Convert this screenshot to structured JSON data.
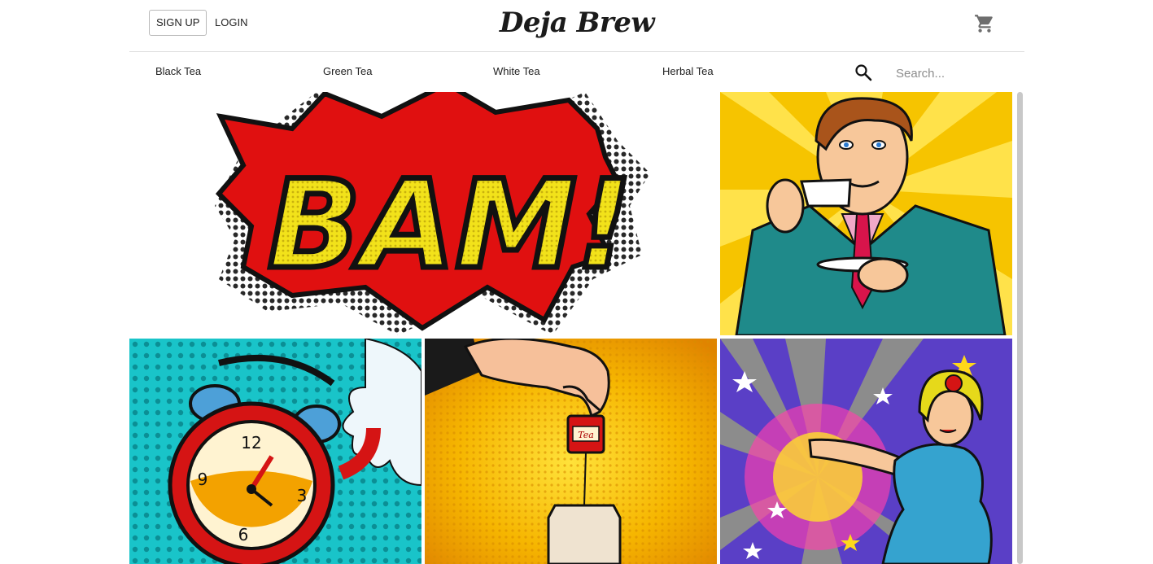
{
  "header": {
    "signup_label": "SIGN UP",
    "login_label": "LOGIN",
    "brand": "Deja Brew",
    "cart_icon": "shopping-cart-icon"
  },
  "nav": {
    "items": [
      {
        "label": "Black Tea"
      },
      {
        "label": "Green Tea"
      },
      {
        "label": "White Tea"
      },
      {
        "label": "Herbal Tea"
      }
    ],
    "search_icon": "search-icon",
    "search_placeholder": "Search..."
  },
  "gallery": {
    "tiles": [
      {
        "name": "bam-comic-tile",
        "caption": "BAM!"
      },
      {
        "name": "tea-gentleman-tile"
      },
      {
        "name": "teapot-clock-tile",
        "clock_numbers": [
          "12",
          "3",
          "6",
          "9"
        ]
      },
      {
        "name": "teabag-hand-tile",
        "tag_text": "Tea"
      },
      {
        "name": "pinup-woman-tile"
      }
    ]
  },
  "colors": {
    "accent_red": "#e01010",
    "comic_yellow": "#f2d21a",
    "comic_cyan": "#19c4c9",
    "comic_orange": "#f0a100",
    "comic_purple": "#5a3fc6"
  }
}
